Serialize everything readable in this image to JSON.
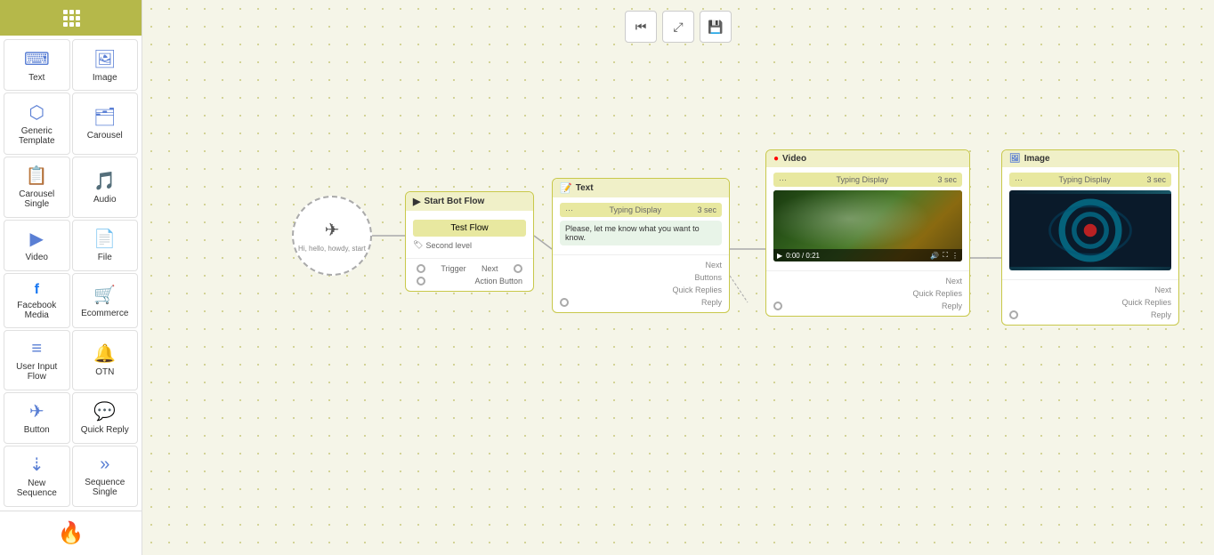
{
  "sidebar": {
    "items": [
      {
        "id": "text",
        "label": "Text",
        "icon": "⌨"
      },
      {
        "id": "image",
        "label": "Image",
        "icon": "🖼"
      },
      {
        "id": "generic-template",
        "label": "Generic Template",
        "icon": "⬡"
      },
      {
        "id": "carousel",
        "label": "Carousel",
        "icon": "🗂"
      },
      {
        "id": "carousel-single",
        "label": "Carousel Single",
        "icon": "📋"
      },
      {
        "id": "audio",
        "label": "Audio",
        "icon": "🎵"
      },
      {
        "id": "video",
        "label": "Video",
        "icon": "▶"
      },
      {
        "id": "file",
        "label": "File",
        "icon": "📄"
      },
      {
        "id": "facebook-media",
        "label": "Facebook Media",
        "icon": "f"
      },
      {
        "id": "ecommerce",
        "label": "Ecommerce",
        "icon": "🛒"
      },
      {
        "id": "user-input-flow",
        "label": "User Input Flow",
        "icon": "≡"
      },
      {
        "id": "otn",
        "label": "OTN",
        "icon": "🔔"
      },
      {
        "id": "button",
        "label": "Button",
        "icon": "✈"
      },
      {
        "id": "quick-reply",
        "label": "Quick Reply",
        "icon": "💬"
      },
      {
        "id": "new-sequence",
        "label": "New Sequence",
        "icon": "⇣"
      },
      {
        "id": "sequence-single",
        "label": "Sequence Single",
        "icon": "»"
      }
    ]
  },
  "toolbar": {
    "reset_label": "⏮",
    "fit_label": "⤢",
    "save_label": "💾"
  },
  "nodes": {
    "start": {
      "text": "Hi, hello, howdy, start"
    },
    "bot_flow": {
      "header": "Start Bot Flow",
      "name": "Test Flow",
      "tag": "Second level",
      "trigger_label": "Trigger",
      "next_label": "Next",
      "action_label": "Action Button"
    },
    "text_node": {
      "header": "Text",
      "typing_label": "Typing Display",
      "typing_sec": "3 sec",
      "message": "Please, let me know what you want to know.",
      "next_label": "Next",
      "buttons_label": "Buttons",
      "quick_replies_label": "Quick Replies",
      "reply_label": "Reply"
    },
    "video_node": {
      "header": "Video",
      "typing_label": "Typing Display",
      "typing_sec": "3 sec",
      "video_time": "0:00 / 0:21",
      "next_label": "Next",
      "quick_replies_label": "Quick Replies",
      "reply_label": "Reply"
    },
    "image_node": {
      "header": "Image",
      "typing_label": "Typing Display",
      "typing_sec": "3 sec",
      "next_label": "Next",
      "quick_replies_label": "Quick Replies",
      "reply_label": "Reply"
    }
  }
}
